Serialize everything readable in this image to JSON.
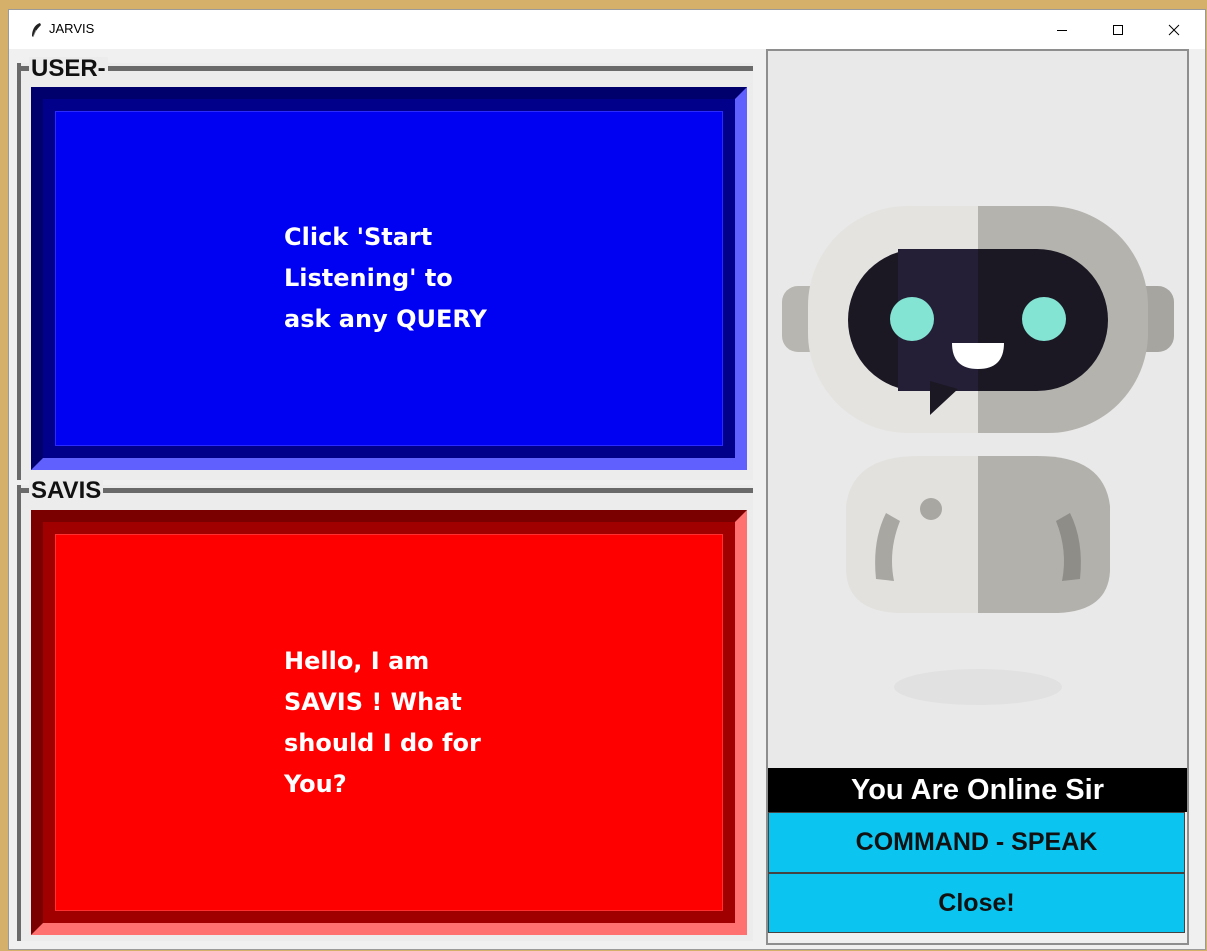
{
  "window": {
    "title": "JARVIS"
  },
  "user_panel": {
    "label": "USER-",
    "text": "Click 'Start\nListening' to\nask any QUERY",
    "color": "#0000ff"
  },
  "assistant_panel": {
    "label": "SAVIS",
    "text": "Hello, I am\nSAVIS ! What\nshould I do for\nYou?",
    "color": "#ff0000"
  },
  "sidebar": {
    "status": "You Are Online Sir",
    "command_button": "COMMAND - SPEAK",
    "close_button": "Close!",
    "button_color": "#0bc4f0"
  },
  "icons": {
    "app": "feather-icon",
    "minimize": "minimize-icon",
    "maximize": "maximize-icon",
    "close": "close-icon",
    "robot": "robot-illustration"
  }
}
